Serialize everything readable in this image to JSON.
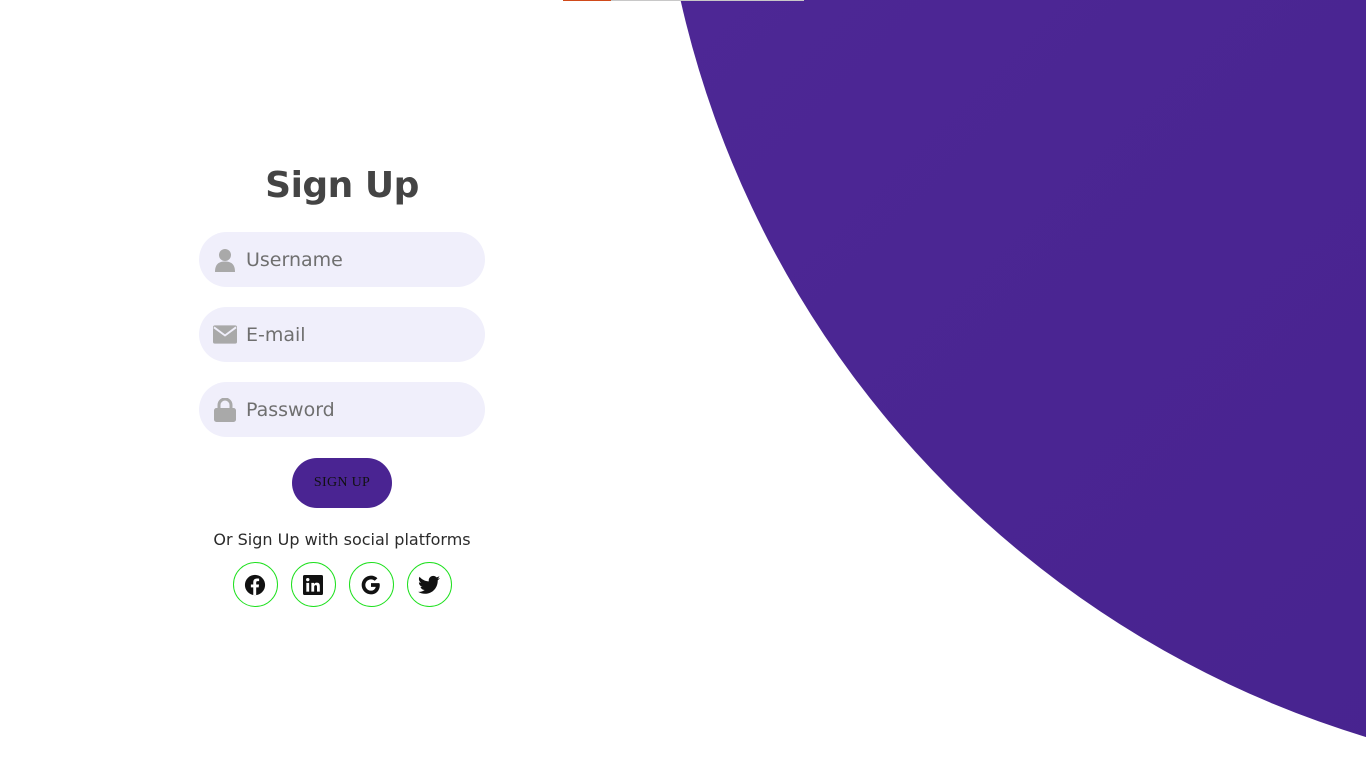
{
  "form": {
    "title": "Sign Up",
    "username_placeholder": "Username",
    "email_placeholder": "E-mail",
    "password_placeholder": "Password",
    "submit_label": "SIGN UP"
  },
  "social": {
    "prompt": "Or Sign Up with social platforms",
    "icons": [
      "facebook-icon",
      "linkedin-icon",
      "google-icon",
      "twitter-icon"
    ]
  },
  "colors": {
    "accent": "#4a2492",
    "field_background": "#f0effb",
    "social_border": "#1ee01e",
    "title": "#444444"
  }
}
